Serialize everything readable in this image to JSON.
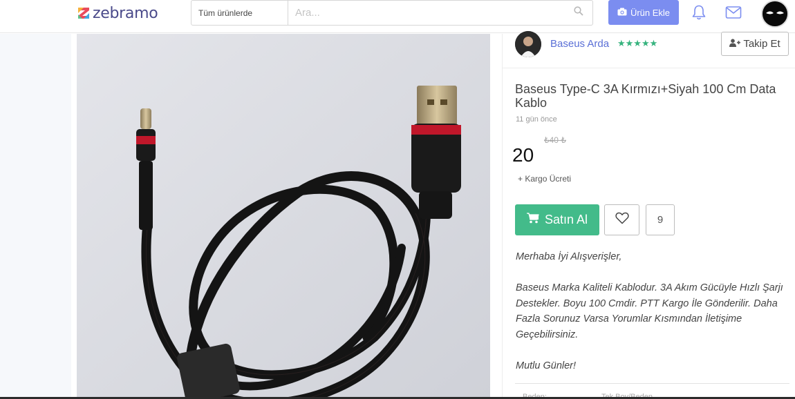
{
  "header": {
    "logo_text": "zebramo",
    "search": {
      "category": "Tüm ürünlerde",
      "placeholder": "Ara..."
    },
    "add_product_label": "Ürün Ekle"
  },
  "seller": {
    "name": "Baseus Arda",
    "stars": "★★★★★",
    "rating_of_5": 5,
    "follow_label": "Takip Et"
  },
  "product": {
    "title": "Baseus Type-C 3A Kırmızı+Siyah 100 Cm Data Kablo",
    "time_ago": "11 gün önce",
    "old_price": "₺40 ₺",
    "price": "20",
    "cargo_note": "+ Kargo Ücreti",
    "buy_label": "Satın Al",
    "favorite_count": "9",
    "description": [
      "Merhaba İyi Alışverişler,",
      "Baseus Marka Kaliteli Kablodur. 3A Akım Gücüyle Hızlı Şarjı Destekler. Boyu 100 Cmdir. PTT Kargo İle Gönderilir. Daha Fazla Sorunuz Varsa Yorumlar Kısmından İletişime Geçebilirsiniz.",
      "Mutlu Günler!"
    ],
    "meta": {
      "label": "Beden:",
      "value": "Tek Boy/Beden"
    }
  },
  "colors": {
    "accent": "#7b8df0",
    "buy": "#43bb8a",
    "seller_link": "#5a6fd6",
    "stars": "#36b37e"
  }
}
